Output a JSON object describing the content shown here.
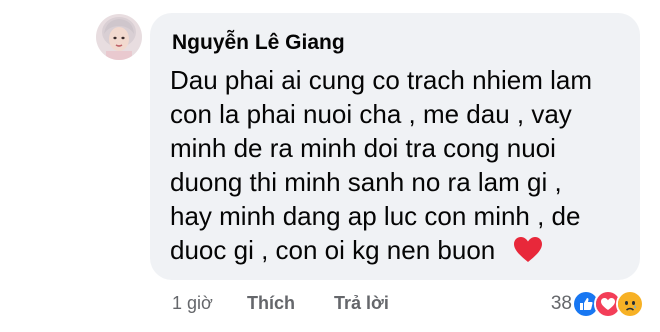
{
  "comment": {
    "author": "Nguyễn Lê Giang",
    "lines": [
      "Dau phai ai cung co trach nhiem lam",
      "con la phai nuoi cha , me dau , vay",
      "minh de ra minh doi tra cong nuoi",
      "duong thi minh sanh no ra lam gi ,",
      "hay minh dang ap luc con minh , de",
      "duoc gi , con oi kg nen buon"
    ],
    "emoji": "heart-icon"
  },
  "actions": {
    "time": "1 giờ",
    "like_label": "Thích",
    "reply_label": "Trả lời"
  },
  "reactions": {
    "count": "38",
    "icons": [
      "like-reaction-icon",
      "love-reaction-icon",
      "sad-reaction-icon"
    ]
  },
  "colors": {
    "bubble_bg": "#f0f2f5",
    "text": "#050505",
    "secondary_text": "#65676b",
    "like_blue": "#1877f2",
    "love_red": "#f33e58",
    "sad_yellow": "#f7b125"
  }
}
